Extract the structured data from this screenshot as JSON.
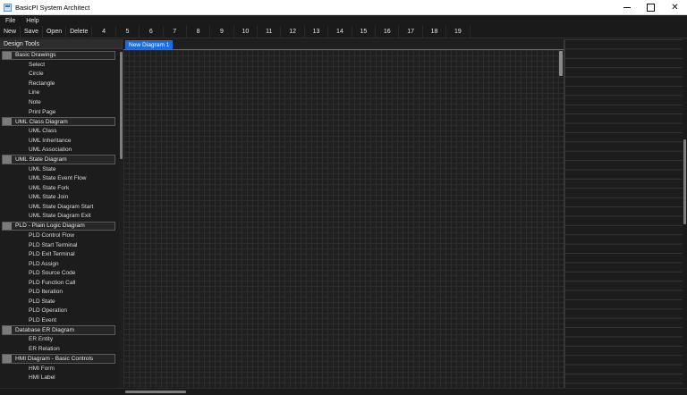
{
  "window": {
    "title": "BasicPI System Architect",
    "controls": {
      "minimize": "",
      "maximize": "",
      "close": "✕"
    }
  },
  "menu": [
    "File",
    "Help"
  ],
  "toolbar": {
    "actions": [
      "New",
      "Save",
      "Open",
      "Delete"
    ],
    "numbers": [
      "4",
      "5",
      "6",
      "7",
      "8",
      "9",
      "10",
      "11",
      "12",
      "13",
      "14",
      "15",
      "16",
      "17",
      "18",
      "19"
    ]
  },
  "design_tools": {
    "header": "Design Tools",
    "groups": [
      {
        "title": "Basic Drawings",
        "items": [
          "Select",
          "Circle",
          "Rectangle",
          "Line",
          "Note",
          "Print Page"
        ]
      },
      {
        "title": "UML Class Diagram",
        "items": [
          "UML Class",
          "UML Inheritance",
          "UML Association"
        ]
      },
      {
        "title": "UML State Diagram",
        "items": [
          "UML State",
          "UML State Event Flow",
          "UML State Fork",
          "UML State Join",
          "UML State Diagram Start",
          "UML State Diagram Exit"
        ]
      },
      {
        "title": "PLD - Plain Logic Diagram",
        "items": [
          "PLD Control Flow",
          "PLD Start Terminal",
          "PLD Exit Terminal",
          "PLD Assign",
          "PLD Source Code",
          "PLD Function Call",
          "PLD Iteration",
          "PLD State",
          "PLD Operation",
          "PLD Event"
        ]
      },
      {
        "title": "Database ER Diagram",
        "items": [
          "ER Entity",
          "ER Relation"
        ]
      },
      {
        "title": "HMI Diagram - Basic Controls",
        "items": [
          "HMI Form",
          "HMI Label"
        ]
      }
    ]
  },
  "diagram": {
    "tabs": [
      "New Diagram 1"
    ]
  },
  "colors": {
    "accent": "#1e6bdb",
    "background": "#1e1e1e",
    "grid": "#2c2c2c"
  }
}
